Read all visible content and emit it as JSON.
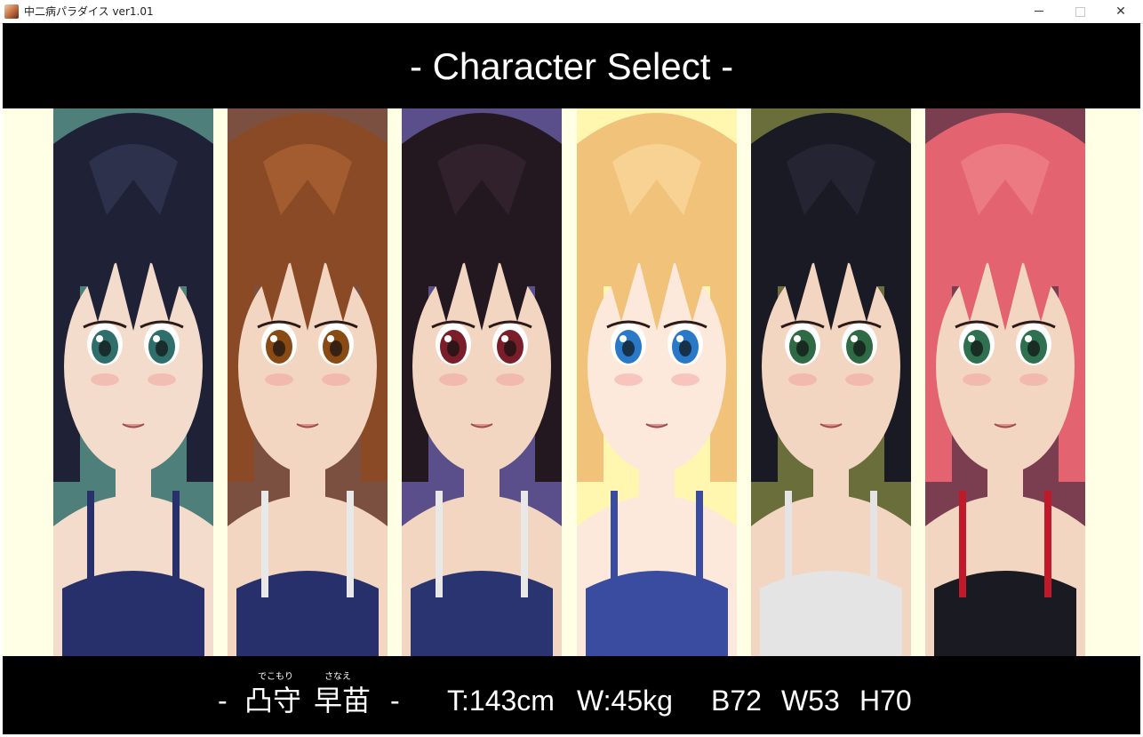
{
  "window": {
    "title": "中二病パラダイス ver1.01",
    "minimize_glyph": "",
    "close_glyph": "✕"
  },
  "header": {
    "title": "- Character Select -"
  },
  "characters": [
    {
      "hair": "#1f2236",
      "hair_hi": "#3a3e5c",
      "bg": "#4e7f7a",
      "skin": "#f3dccb",
      "iris": "#2e6f6c",
      "suit": "#27306a",
      "strap": "#27306a"
    },
    {
      "hair": "#8a4a25",
      "hair_hi": "#b86b3a",
      "bg": "#7c5040",
      "skin": "#f3d6c2",
      "iris": "#8a4a14",
      "suit": "#27306a",
      "strap": "#e8e8e8"
    },
    {
      "hair": "#241820",
      "hair_hi": "#3d2a36",
      "bg": "#5a4f8a",
      "skin": "#f3d6c2",
      "iris": "#7a1f2a",
      "suit": "#2a3470",
      "strap": "#e8e8e8"
    },
    {
      "hair": "#f0c27a",
      "hair_hi": "#ffe0a6",
      "bg": "#fff6b0",
      "skin": "#fde9dc",
      "iris": "#2a78c8",
      "suit": "#3a4ca0",
      "strap": "#3a4ca0"
    },
    {
      "hair": "#1a1a24",
      "hair_hi": "#2e2e3e",
      "bg": "#6a6e3a",
      "skin": "#f3d6c2",
      "iris": "#2e6a44",
      "suit": "#e4e4e4",
      "strap": "#e4e4e4"
    },
    {
      "hair": "#e36470",
      "hair_hi": "#f48c94",
      "bg": "#7a3e50",
      "skin": "#f3d6c2",
      "iris": "#2e7050",
      "suit": "#1a1a22",
      "strap": "#c01a2a"
    }
  ],
  "footer": {
    "dash_left": "-",
    "surname": "凸守",
    "surname_ruby": "でこもり",
    "given_name": "早苗",
    "given_name_ruby": "さなえ",
    "dash_right": "-",
    "height": "T:143cm",
    "weight": "W:45kg",
    "bust": "B72",
    "waist": "W53",
    "hip": "H70"
  }
}
